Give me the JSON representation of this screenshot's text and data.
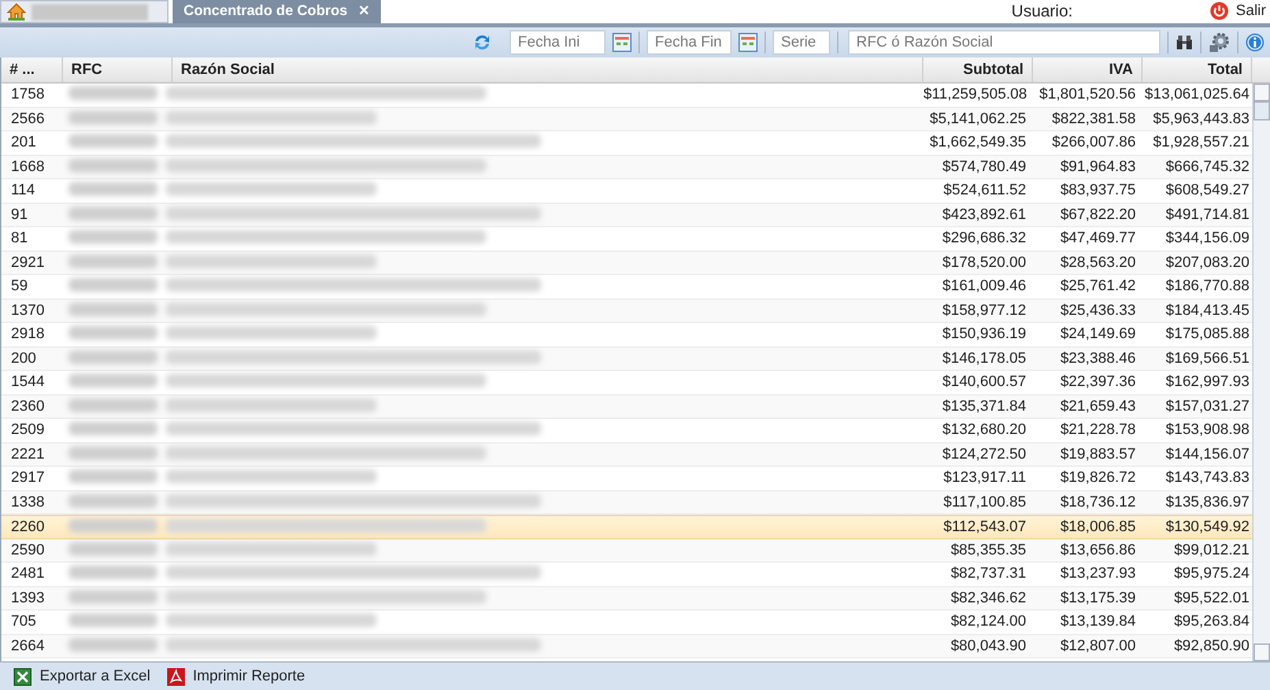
{
  "tabs": [
    {
      "kind": "home",
      "selected": false
    },
    {
      "kind": "page",
      "label": "Concentrado de Cobros",
      "close": "✕",
      "selected": true
    }
  ],
  "user": {
    "label": "Usuario:",
    "logout": "Salir"
  },
  "toolbar": {
    "fecha_ini": {
      "placeholder": "Fecha Ini"
    },
    "fecha_fin": {
      "placeholder": "Fecha Fin"
    },
    "serie": {
      "placeholder": "Serie"
    },
    "search": {
      "placeholder": "RFC ó Razón Social"
    }
  },
  "table": {
    "columns": [
      "# ...",
      "RFC",
      "Razón Social",
      "Subtotal",
      "IVA",
      "Total"
    ],
    "rows": [
      {
        "id": "1758",
        "subtotal": "$11,259,505.08",
        "iva": "$1,801,520.56",
        "total": "$13,061,025.64",
        "selected": false
      },
      {
        "id": "2566",
        "subtotal": "$5,141,062.25",
        "iva": "$822,381.58",
        "total": "$5,963,443.83",
        "selected": false
      },
      {
        "id": "201",
        "subtotal": "$1,662,549.35",
        "iva": "$266,007.86",
        "total": "$1,928,557.21",
        "selected": false
      },
      {
        "id": "1668",
        "subtotal": "$574,780.49",
        "iva": "$91,964.83",
        "total": "$666,745.32",
        "selected": false
      },
      {
        "id": "114",
        "subtotal": "$524,611.52",
        "iva": "$83,937.75",
        "total": "$608,549.27",
        "selected": false
      },
      {
        "id": "91",
        "subtotal": "$423,892.61",
        "iva": "$67,822.20",
        "total": "$491,714.81",
        "selected": false
      },
      {
        "id": "81",
        "subtotal": "$296,686.32",
        "iva": "$47,469.77",
        "total": "$344,156.09",
        "selected": false
      },
      {
        "id": "2921",
        "subtotal": "$178,520.00",
        "iva": "$28,563.20",
        "total": "$207,083.20",
        "selected": false
      },
      {
        "id": "59",
        "subtotal": "$161,009.46",
        "iva": "$25,761.42",
        "total": "$186,770.88",
        "selected": false
      },
      {
        "id": "1370",
        "subtotal": "$158,977.12",
        "iva": "$25,436.33",
        "total": "$184,413.45",
        "selected": false
      },
      {
        "id": "2918",
        "subtotal": "$150,936.19",
        "iva": "$24,149.69",
        "total": "$175,085.88",
        "selected": false
      },
      {
        "id": "200",
        "subtotal": "$146,178.05",
        "iva": "$23,388.46",
        "total": "$169,566.51",
        "selected": false
      },
      {
        "id": "1544",
        "subtotal": "$140,600.57",
        "iva": "$22,397.36",
        "total": "$162,997.93",
        "selected": false
      },
      {
        "id": "2360",
        "subtotal": "$135,371.84",
        "iva": "$21,659.43",
        "total": "$157,031.27",
        "selected": false
      },
      {
        "id": "2509",
        "subtotal": "$132,680.20",
        "iva": "$21,228.78",
        "total": "$153,908.98",
        "selected": false
      },
      {
        "id": "2221",
        "subtotal": "$124,272.50",
        "iva": "$19,883.57",
        "total": "$144,156.07",
        "selected": false
      },
      {
        "id": "2917",
        "subtotal": "$123,917.11",
        "iva": "$19,826.72",
        "total": "$143,743.83",
        "selected": false
      },
      {
        "id": "1338",
        "subtotal": "$117,100.85",
        "iva": "$18,736.12",
        "total": "$135,836.97",
        "selected": false
      },
      {
        "id": "2260",
        "subtotal": "$112,543.07",
        "iva": "$18,006.85",
        "total": "$130,549.92",
        "selected": true
      },
      {
        "id": "2590",
        "subtotal": "$85,355.35",
        "iva": "$13,656.86",
        "total": "$99,012.21",
        "selected": false
      },
      {
        "id": "2481",
        "subtotal": "$82,737.31",
        "iva": "$13,237.93",
        "total": "$95,975.24",
        "selected": false
      },
      {
        "id": "1393",
        "subtotal": "$82,346.62",
        "iva": "$13,175.39",
        "total": "$95,522.01",
        "selected": false
      },
      {
        "id": "705",
        "subtotal": "$82,124.00",
        "iva": "$13,139.84",
        "total": "$95,263.84",
        "selected": false
      },
      {
        "id": "2664",
        "subtotal": "$80,043.90",
        "iva": "$12,807.00",
        "total": "$92,850.90",
        "selected": false
      }
    ]
  },
  "footer": [
    "Exportar a Excel",
    "Imprimir Reporte"
  ]
}
